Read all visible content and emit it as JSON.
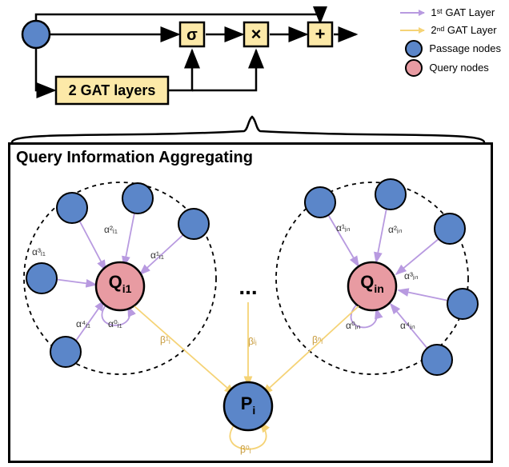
{
  "legend": {
    "layer1": "1ˢᵗ GAT Layer",
    "layer2": "2ⁿᵈ GAT Layer",
    "passage": "Passage nodes",
    "query": "Query nodes"
  },
  "top": {
    "gat_box": "2 GAT layers",
    "sigma": "σ",
    "plus": "+",
    "times": "×"
  },
  "big_title": "Query Information Aggregating",
  "nodes": {
    "qi1": "Q",
    "qi1_sub": "i1",
    "qin": "Q",
    "qin_sub": "in",
    "pi": "P",
    "pi_sub": "i",
    "dots": "..."
  },
  "alphas_left": {
    "a0": "α⁰ᵢ₁",
    "a1": "α¹ᵢ₁",
    "a2": "α²ᵢ₁",
    "a3": "α³ᵢ₁",
    "a4": "α⁴ᵢ₁"
  },
  "alphas_right": {
    "a0": "α⁰ᵢₙ",
    "a1": "α¹ᵢₙ",
    "a2": "α²ᵢₙ",
    "a3": "α³ᵢₙ",
    "a4": "α⁴ᵢₙ"
  },
  "betas": {
    "b0": "β⁰ᵢ",
    "b1": "β¹ᵢ",
    "bj": "βʲᵢ",
    "bn": "βⁿᵢ"
  },
  "chart_data": {
    "type": "diagram",
    "description": "GAT-based query information aggregation architecture",
    "top_flow": {
      "input": "Passage embedding (blue node)",
      "branches": [
        {
          "path": "input -> sigma",
          "op": "σ gate"
        },
        {
          "path": "input -> 2 GAT layers -> sigma",
          "op": "σ gate input"
        },
        {
          "path": "2 GAT layers output -> × (with sigma output)"
        },
        {
          "path": "input residual -> +"
        },
        {
          "path": "× output -> + -> output"
        }
      ]
    },
    "aggregation": {
      "passage_node": "P_i",
      "query_nodes": [
        "Q_i1",
        "...",
        "Q_in"
      ],
      "layer1_edges": {
        "description": "1st GAT Layer attention (purple) from passage neighbors to each query node and self-loop",
        "weights": [
          "α⁰",
          "α¹",
          "α²",
          "α³",
          "α⁴"
        ]
      },
      "layer2_edges": {
        "description": "2nd GAT Layer attention (orange) from query nodes to passage node and self-loop",
        "weights": [
          "β⁰",
          "β¹",
          "βʲ",
          "βⁿ"
        ]
      }
    }
  }
}
